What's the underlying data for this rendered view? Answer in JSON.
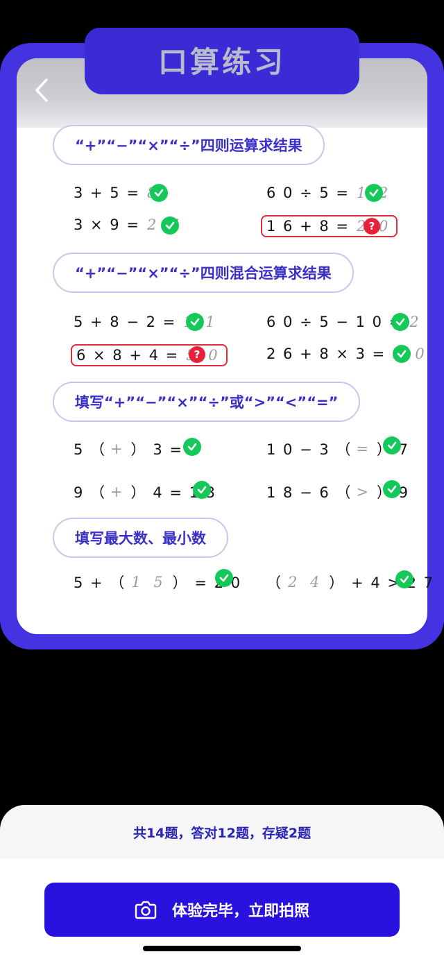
{
  "header": {
    "title": "口算练习",
    "back_icon": "chevron-left-icon"
  },
  "sections": [
    {
      "title": "“+”“−”“×”“÷”四则运算求结果",
      "items": [
        {
          "expr": "3 + 5 =",
          "answer": "8",
          "status": "correct"
        },
        {
          "expr": "6 0 ÷ 5 =",
          "answer": "1 2",
          "status": "correct"
        },
        {
          "expr": "3 × 9 =",
          "answer": "2 7",
          "status": "correct"
        },
        {
          "expr": "1 6 + 8 =",
          "answer": "2 0",
          "status": "doubt"
        }
      ]
    },
    {
      "title": "“+”“−”“×”“÷”四则混合运算求结果",
      "items": [
        {
          "expr": "5 + 8 − 2 =",
          "answer": "1 1",
          "status": "correct"
        },
        {
          "expr": "6 0 ÷ 5 − 1 0 =",
          "answer": "2",
          "status": "correct"
        },
        {
          "expr": "6 × 8 + 4 =",
          "answer": "5 0",
          "status": "doubt"
        },
        {
          "expr": "2 6 + 8 × 3 =",
          "answer": "5 0",
          "status": "correct"
        }
      ]
    },
    {
      "title": "填写“+”“−”“×”“÷”或“>”“<”“=”",
      "items": [
        {
          "left": "5 （",
          "answer": "+",
          "right": "） 3 = 8",
          "status": "correct"
        },
        {
          "left": "1 0 − 3 （",
          "answer": "=",
          "right": "） 7",
          "status": "correct"
        },
        {
          "left": "9 （",
          "answer": "+",
          "right": "） 4 = 1 3",
          "status": "correct"
        },
        {
          "left": "1 8 − 6 （",
          "answer": ">",
          "right": "） 9",
          "status": "correct"
        }
      ]
    },
    {
      "title": "填写最大数、最小数",
      "items": [
        {
          "left": "5 + （",
          "answer": "1 5",
          "right": "） = 2 0",
          "status": "correct"
        },
        {
          "left": "（",
          "answer": "2 4",
          "right": "） + 4 > 2 7",
          "status": "correct"
        }
      ]
    }
  ],
  "summary": "共14题，答对12题，存疑2题",
  "cta": {
    "label": "体验完毕，立即拍照",
    "icon": "camera-icon"
  },
  "colors": {
    "brand": "#4433e0",
    "correct": "#14c95a",
    "doubt": "#e8213a",
    "cta": "#2a12de"
  }
}
